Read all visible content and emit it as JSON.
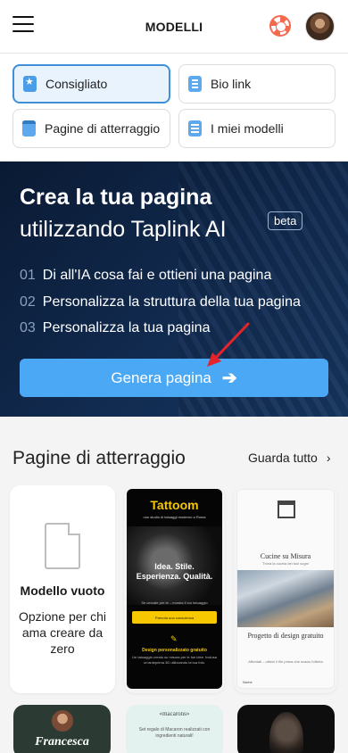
{
  "header": {
    "title": "MODELLI",
    "menu_icon": "hamburger-menu-icon",
    "help_icon": "lifebuoy-icon",
    "avatar_icon": "user-avatar"
  },
  "categories": [
    {
      "label": "Consigliato",
      "icon": "star-doc-icon",
      "active": true
    },
    {
      "label": "Bio link",
      "icon": "list-doc-icon",
      "active": false
    },
    {
      "label": "Pagine di atterraggio",
      "icon": "landing-page-icon",
      "active": false
    },
    {
      "label": "I miei modelli",
      "icon": "layers-doc-icon",
      "active": false
    }
  ],
  "hero": {
    "title": "Crea la tua pagina",
    "subtitle": "utilizzando Taplink AI",
    "badge": "beta",
    "steps": [
      {
        "num": "01",
        "text": "Di all'IA cosa fai e ottieni una pagina"
      },
      {
        "num": "02",
        "text": "Personalizza la struttura della tua pagina"
      },
      {
        "num": "03",
        "text": "Personalizza la tua pagina"
      }
    ],
    "button": "Genera pagina",
    "button_icon": "arrow-right-icon",
    "accent": "#4ba8f5",
    "annotation_color": "#e5242a"
  },
  "section": {
    "title": "Pagine di atterraggio",
    "see_all": "Guarda tutto",
    "blank_card": {
      "title": "Modello vuoto",
      "description": "Opzione per chi ama creare da zero",
      "icon": "blank-file-icon"
    },
    "templates": {
      "tattoom": {
        "brand": "Tattoom",
        "tagline": "uno studio di tatuaggi moderno a Roma",
        "headline_1": "Idea. Stile.",
        "headline_2": "Esperienza. Qualità.",
        "small": "Se cercate per te – mostra il tuo tatuaggio",
        "button": "Prenota una consulenza",
        "design": "Design personalizzato gratuito",
        "design_desc": "Un tatuaggio creato su misura per le tue idee. Inclusa un'anteprima 3D utilizzando la tua foto."
      },
      "cucine": {
        "title": "Cucine su Misura",
        "small": "Trova la cucina dei tuoi sogni",
        "project": "Progetto di design gratuito",
        "desc": "Affrettati – ottieni il file prima che scada l'offerta",
        "field": "Nome"
      },
      "francesca": {
        "name": "Francesca"
      },
      "macaron": {
        "brand": "«macarons»",
        "desc": "Set regalo di Macaron realizzati con ingredienti naturali!"
      }
    }
  }
}
